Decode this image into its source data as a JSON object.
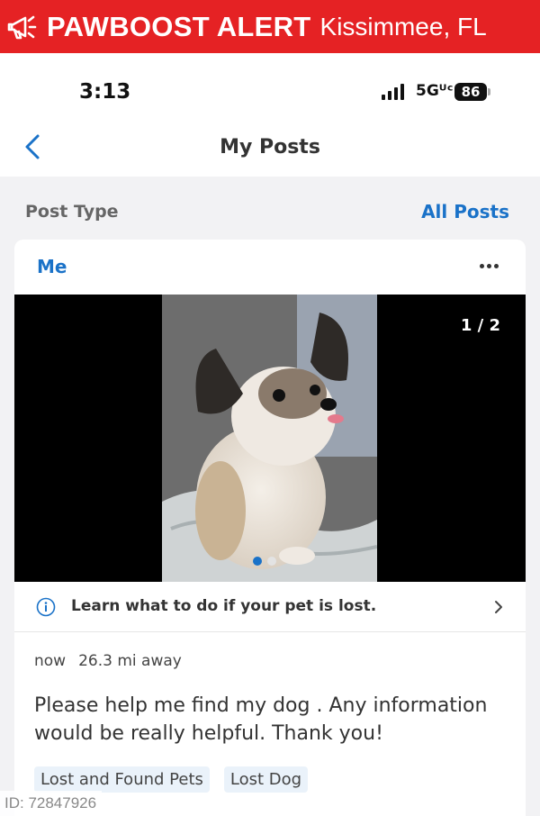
{
  "banner": {
    "brand": "PAWBOOST ALERT",
    "city": "Kissimmee, FL",
    "icon": "megaphone-icon",
    "color": "#e52224"
  },
  "status_bar": {
    "time": "3:13",
    "network": "5Gᵁᶜ",
    "battery": "86"
  },
  "nav": {
    "title": "My Posts",
    "back_icon": "chevron-left-icon"
  },
  "filter": {
    "label": "Post Type",
    "value": "All Posts"
  },
  "post": {
    "author": "Me",
    "more_icon": "more-horizontal-icon",
    "gallery": {
      "counter": "1 / 2",
      "image": "dog-photo",
      "active_index": 0,
      "total": 2
    },
    "learn": {
      "text": "Learn what to do if your pet is lost.",
      "icon": "info-icon"
    },
    "time": "now",
    "distance": "26.3 mi away",
    "description": "Please help me find my dog . Any information would be really helpful. Thank you!",
    "tags": [
      "Lost and Found Pets",
      "Lost Dog"
    ]
  },
  "id_label": "ID: 72847926",
  "colors": {
    "accent": "#1a72c8",
    "alert": "#e52224"
  }
}
